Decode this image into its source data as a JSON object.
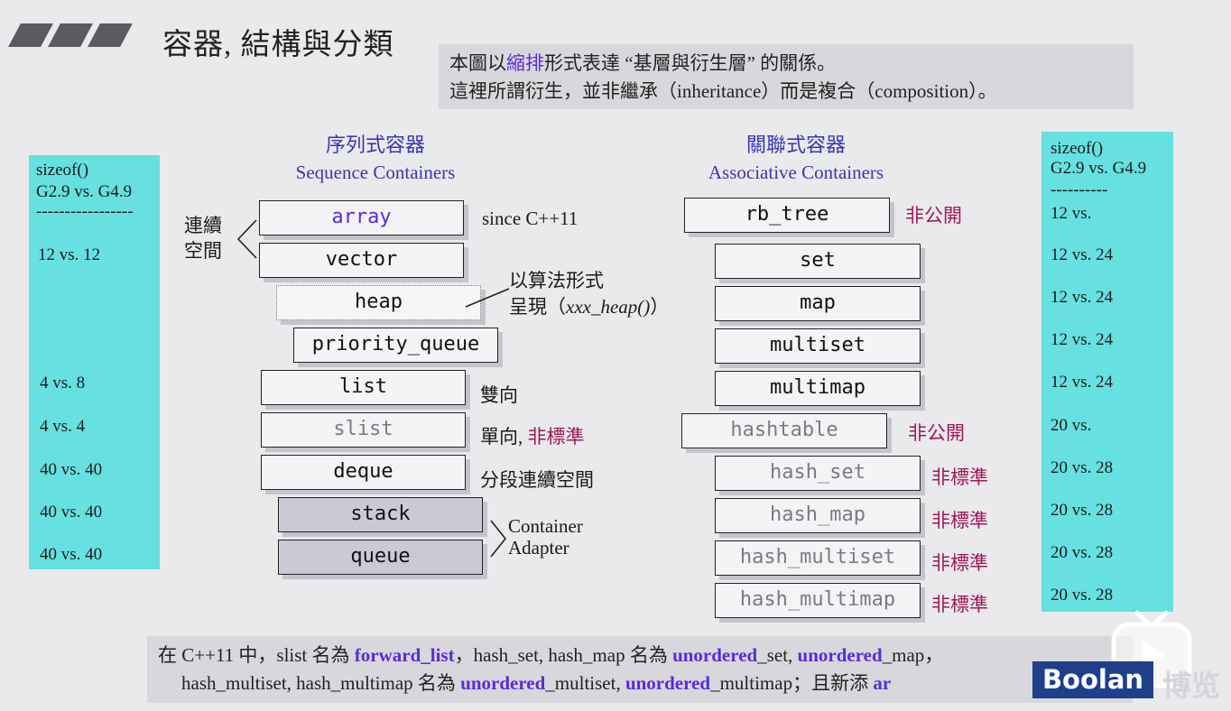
{
  "header": {
    "title": "容器, 結構與分類"
  },
  "note": {
    "line1_a": "本圖以",
    "line1_b": "縮排",
    "line1_c": "形式表達 “基層與衍生層” 的關係。",
    "line2": "這裡所謂衍生，並非繼承（inheritance）而是複合（composition）。"
  },
  "sequence": {
    "title_zh": "序列式容器",
    "title_en": "Sequence Containers",
    "group_continuous": [
      "連續",
      "空間"
    ],
    "items": [
      "array",
      "vector",
      "heap",
      "priority_queue",
      "list",
      "slist",
      "deque",
      "stack",
      "queue"
    ],
    "labels": {
      "array": "since C++11",
      "heap": [
        "以算法形式",
        "呈現（",
        "xxx_heap()",
        "）"
      ],
      "list": "雙向",
      "slist_a": "單向, ",
      "slist_b": "非標準",
      "deque": "分段連續空間",
      "adapter": [
        "Container",
        "Adapter"
      ]
    }
  },
  "associative": {
    "title_zh": "關聯式容器",
    "title_en": "Associative Containers",
    "items": [
      "rb_tree",
      "set",
      "map",
      "multiset",
      "multimap",
      "hashtable",
      "hash_set",
      "hash_map",
      "hash_multiset",
      "hash_multimap"
    ],
    "labels": {
      "rb_tree": "非公開",
      "hashtable": "非公開",
      "hash_set": "非標準",
      "hash_map": "非標準",
      "hash_multiset": "非標準",
      "hash_multimap": "非標準"
    }
  },
  "left_sizeof": {
    "head": [
      "sizeof()",
      "G2.9 vs. G4.9",
      "-----------------"
    ],
    "values": [
      "12 vs. 12",
      "4   vs. 8",
      "4   vs. 4",
      "40 vs. 40",
      "40 vs. 40",
      "40 vs. 40"
    ]
  },
  "right_sizeof": {
    "head": [
      "sizeof()",
      "G2.9 vs. G4.9",
      "----------"
    ],
    "values": [
      "12 vs.",
      "12 vs. 24",
      "12 vs. 24",
      "12 vs. 24",
      "12 vs. 24",
      "20 vs.",
      "20 vs. 28",
      "20 vs. 28",
      "20 vs. 28",
      "20 vs. 28"
    ]
  },
  "bottom_note": {
    "l1_a": "在 C++11 中，slist 名為 ",
    "l1_b": "forward_list",
    "l1_c": "，hash_set, hash_map 名為 ",
    "l1_d": "unordered",
    "l1_e": "_set, ",
    "l1_f": "unordered",
    "l1_g": "_map，",
    "l2_a": "hash_multiset, hash_multimap 名為 ",
    "l2_b": "unordered",
    "l2_c": "_multiset, ",
    "l2_d": "unordered",
    "l2_e": "_multimap；且新添 ",
    "l2_f": "ar"
  },
  "logo": {
    "brand": "Boolan",
    "zh": "博览"
  },
  "colors": {
    "cyan": "#66e0e0",
    "purple": "#5a2ae0",
    "red": "#a0185a",
    "heading": "#3a35b8",
    "brand": "#1e3f8a"
  }
}
